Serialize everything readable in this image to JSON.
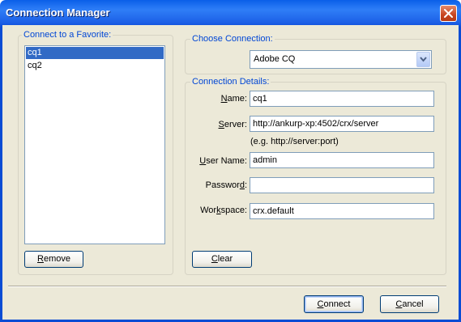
{
  "window": {
    "title": "Connection Manager"
  },
  "favorites": {
    "label": "Connect to a Favorite:",
    "items": [
      "cq1",
      "cq2"
    ],
    "selected_index": 0,
    "remove_label_first": "R",
    "remove_label_rest": "emove"
  },
  "choose_connection": {
    "label": "Choose Connection:",
    "selected": "Adobe CQ"
  },
  "details": {
    "label": "Connection Details:",
    "name": {
      "label_first": "N",
      "label_rest": "ame:",
      "value": "cq1"
    },
    "server": {
      "label_first": "S",
      "label_rest": "erver:",
      "value": "http://ankurp-xp:4502/crx/server",
      "hint": "(e.g. http://server:port)"
    },
    "username": {
      "label_first": "U",
      "label_rest": "ser Name:",
      "value": "admin"
    },
    "password": {
      "label_pre": "Passwor",
      "label_u": "d",
      "label_post": ":",
      "value": ""
    },
    "workspace": {
      "label_pre": "Wor",
      "label_u": "k",
      "label_post": "space:",
      "value": "crx.default"
    },
    "clear_label_first": "C",
    "clear_label_rest": "lear"
  },
  "footer": {
    "connect_first": "C",
    "connect_rest": "onnect",
    "cancel_first": "C",
    "cancel_rest": "ancel"
  },
  "colors": {
    "titlebar": "#0a4cd4",
    "group_label": "#0046d5",
    "selection": "#316ac5",
    "dialog_bg": "#ece9d8",
    "close_button": "#c84520"
  }
}
